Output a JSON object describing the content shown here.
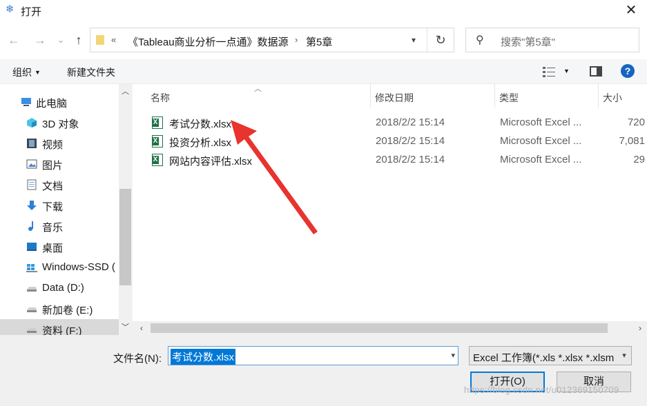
{
  "window": {
    "title": "打开",
    "close_glyph": "✕"
  },
  "nav": {
    "back_glyph": "←",
    "forward_glyph": "→",
    "recent_glyph": "⌄",
    "up_glyph": "↑",
    "address": {
      "chevron": "«",
      "segments": [
        "《Tableau商业分析一点通》数据源",
        "第5章"
      ],
      "separator": "›"
    },
    "refresh_glyph": "↻",
    "search_placeholder": "搜索\"第5章\""
  },
  "toolbar": {
    "organize": "组织",
    "new_folder": "新建文件夹",
    "help": "?"
  },
  "sidebar": {
    "items": [
      {
        "label": "此电脑",
        "icon": "computer-icon"
      },
      {
        "label": "3D 对象",
        "icon": "3d-objects-icon"
      },
      {
        "label": "视频",
        "icon": "video-icon"
      },
      {
        "label": "图片",
        "icon": "pictures-icon"
      },
      {
        "label": "文档",
        "icon": "documents-icon"
      },
      {
        "label": "下载",
        "icon": "download-icon"
      },
      {
        "label": "音乐",
        "icon": "music-icon"
      },
      {
        "label": "桌面",
        "icon": "desktop-icon"
      },
      {
        "label": "Windows-SSD (",
        "icon": "windows-drive-icon"
      },
      {
        "label": "Data (D:)",
        "icon": "drive-icon"
      },
      {
        "label": "新加卷 (E:)",
        "icon": "drive-icon"
      },
      {
        "label": "资料 (F:)",
        "icon": "drive-icon"
      }
    ],
    "selected_index": 11
  },
  "columns": {
    "name": "名称",
    "modified": "修改日期",
    "type": "类型",
    "size": "大小"
  },
  "files": [
    {
      "name": "考试分数.xlsx",
      "modified": "2018/2/2 15:14",
      "type": "Microsoft Excel ...",
      "size": "720"
    },
    {
      "name": "投资分析.xlsx",
      "modified": "2018/2/2 15:14",
      "type": "Microsoft Excel ...",
      "size": "7,081"
    },
    {
      "name": "网站内容评估.xlsx",
      "modified": "2018/2/2 15:14",
      "type": "Microsoft Excel ...",
      "size": "29"
    }
  ],
  "bottom": {
    "filename_label": "文件名(N):",
    "filename_value": "考试分数.xlsx",
    "filetype_value": "Excel 工作簿(*.xls *.xlsx *.xlsm",
    "open_button": "打开(O)",
    "cancel_button": "取消",
    "watermark": "https://blog.csdn.net/u012369150709"
  },
  "colors": {
    "accent": "#0078d7",
    "annotation_arrow": "#e8332e",
    "excel_green": "#1e7145"
  }
}
